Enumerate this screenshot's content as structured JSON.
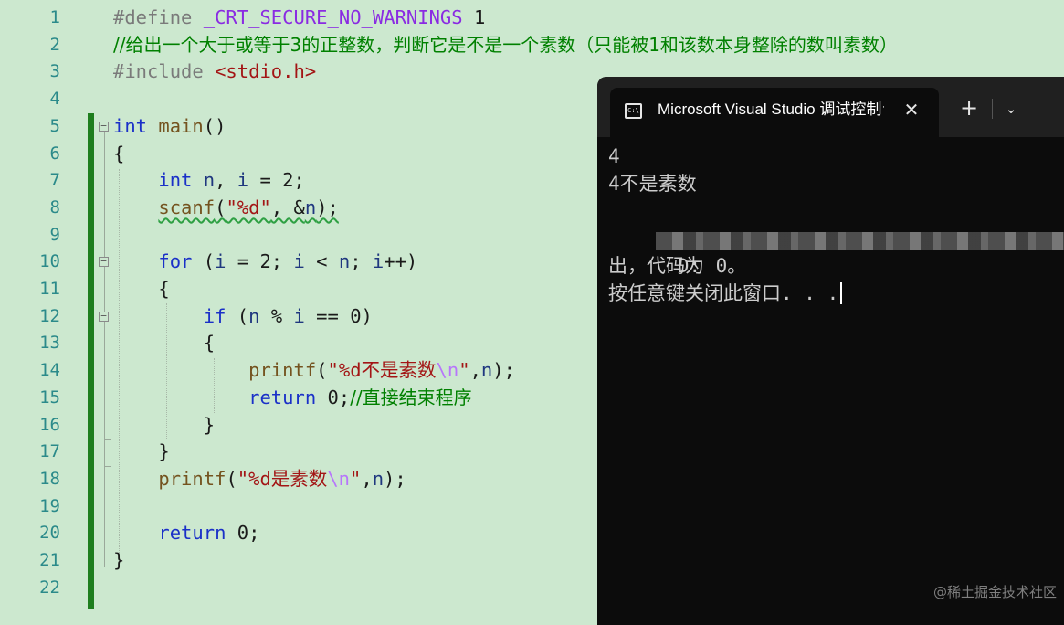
{
  "editor": {
    "line_numbers": [
      "1",
      "2",
      "3",
      "4",
      "5",
      "6",
      "7",
      "8",
      "9",
      "10",
      "11",
      "12",
      "13",
      "14",
      "15",
      "16",
      "17",
      "18",
      "19",
      "20",
      "21",
      "22"
    ],
    "code": {
      "l1": {
        "pp": "#define",
        "macro": "_CRT_SECURE_NO_WARNINGS",
        "num": "1"
      },
      "l2": {
        "comment": "//给出一个大于或等于3的正整数，判断它是不是一个素数（只能被1和该数本身整除的数叫素数）"
      },
      "l3": {
        "pp": "#include",
        "file": "<stdio.h>"
      },
      "l5": {
        "kw": "int",
        "fn": "main",
        "rest": "()"
      },
      "l6": {
        "brace": "{"
      },
      "l7": {
        "kw": "int",
        "v1": "n",
        "sep": ", ",
        "v2": "i",
        "rest": " = 2;"
      },
      "l8": {
        "fn": "scanf",
        "open": "(",
        "str": "\"%d\"",
        "mid": ", &",
        "var": "n",
        "close": ");"
      },
      "l10": {
        "kw": "for",
        "open": " (",
        "v1": "i",
        "a": " = 2; ",
        "v2": "i",
        "b": " < ",
        "v3": "n",
        "c": "; ",
        "v4": "i",
        "d": "++)"
      },
      "l11": {
        "brace": "{"
      },
      "l12": {
        "kw": "if",
        "open": " (",
        "v1": "n",
        "a": " % ",
        "v2": "i",
        "b": " == 0)"
      },
      "l13": {
        "brace": "{"
      },
      "l14": {
        "fn": "printf",
        "open": "(",
        "str": "\"%d不是素数",
        "esc": "\\n",
        "strend": "\"",
        "mid": ",",
        "var": "n",
        "close": ");"
      },
      "l15": {
        "kw": "return",
        "rest": " 0;",
        "comment": "//直接结束程序"
      },
      "l16": {
        "brace": "}"
      },
      "l17": {
        "brace": "}"
      },
      "l18": {
        "fn": "printf",
        "open": "(",
        "str": "\"%d是素数",
        "esc": "\\n",
        "strend": "\"",
        "mid": ",",
        "var": "n",
        "close": ");"
      },
      "l20": {
        "kw": "return",
        "rest": " 0;"
      },
      "l21": {
        "brace": "}"
      }
    }
  },
  "terminal": {
    "tab_title": "Microsoft Visual Studio 调试控制台",
    "tab_icon_text": "C:\\",
    "close_glyph": "✕",
    "new_tab_glyph": "+",
    "dropdown_glyph": "⌄",
    "lines": [
      "4",
      "4不是素数",
      "",
      "D:",
      "出，代码为 0。",
      "按任意键关闭此窗口. . ."
    ]
  },
  "watermark": "@稀土掘金技术社区",
  "colors": {
    "editor_bg": "#cce8cf",
    "keyword": "#1a30c8",
    "comment": "#008000",
    "string": "#a31515",
    "change_bar": "#1e7e1e",
    "terminal_bg": "#0c0c0c"
  }
}
